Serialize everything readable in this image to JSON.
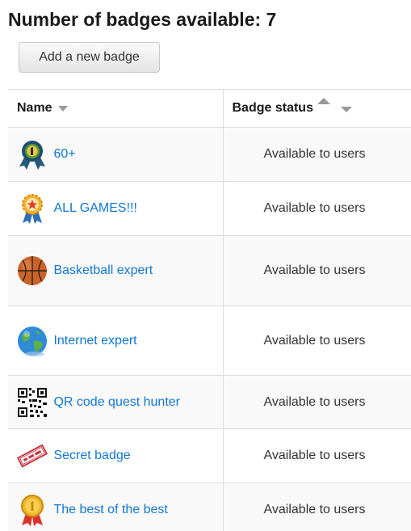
{
  "page": {
    "title": "Number of badges available: 7",
    "add_button_label": "Add a new badge"
  },
  "table": {
    "columns": [
      {
        "label": "Name"
      },
      {
        "label": "Badge status"
      }
    ],
    "rows": [
      {
        "name": "60+",
        "status": "Available to users",
        "icon": "ribbon-medal-icon"
      },
      {
        "name": "ALL GAMES!!!",
        "status": "Available to users",
        "icon": "star-medal-icon"
      },
      {
        "name": "Basketball expert",
        "status": "Available to users",
        "icon": "basketball-icon"
      },
      {
        "name": "Internet expert",
        "status": "Available to users",
        "icon": "globe-icon"
      },
      {
        "name": "QR code quest hunter",
        "status": "Available to users",
        "icon": "qr-code-icon"
      },
      {
        "name": "Secret badge",
        "status": "Available to users",
        "icon": "top-secret-stamp-icon"
      },
      {
        "name": "The best of the best",
        "status": "Available to users",
        "icon": "gold-medal-icon"
      }
    ]
  },
  "colors": {
    "link": "#1177d1",
    "row_alt": "#f9f9f9",
    "border": "#dddddd"
  }
}
